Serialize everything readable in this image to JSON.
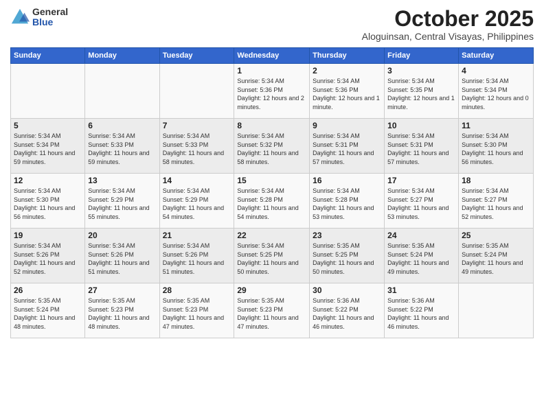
{
  "logo": {
    "general": "General",
    "blue": "Blue"
  },
  "header": {
    "month": "October 2025",
    "location": "Aloguinsan, Central Visayas, Philippines"
  },
  "weekdays": [
    "Sunday",
    "Monday",
    "Tuesday",
    "Wednesday",
    "Thursday",
    "Friday",
    "Saturday"
  ],
  "weeks": [
    [
      {
        "day": "",
        "sunrise": "",
        "sunset": "",
        "daylight": ""
      },
      {
        "day": "",
        "sunrise": "",
        "sunset": "",
        "daylight": ""
      },
      {
        "day": "",
        "sunrise": "",
        "sunset": "",
        "daylight": ""
      },
      {
        "day": "1",
        "sunrise": "Sunrise: 5:34 AM",
        "sunset": "Sunset: 5:36 PM",
        "daylight": "Daylight: 12 hours and 2 minutes."
      },
      {
        "day": "2",
        "sunrise": "Sunrise: 5:34 AM",
        "sunset": "Sunset: 5:36 PM",
        "daylight": "Daylight: 12 hours and 1 minute."
      },
      {
        "day": "3",
        "sunrise": "Sunrise: 5:34 AM",
        "sunset": "Sunset: 5:35 PM",
        "daylight": "Daylight: 12 hours and 1 minute."
      },
      {
        "day": "4",
        "sunrise": "Sunrise: 5:34 AM",
        "sunset": "Sunset: 5:34 PM",
        "daylight": "Daylight: 12 hours and 0 minutes."
      }
    ],
    [
      {
        "day": "5",
        "sunrise": "Sunrise: 5:34 AM",
        "sunset": "Sunset: 5:34 PM",
        "daylight": "Daylight: 11 hours and 59 minutes."
      },
      {
        "day": "6",
        "sunrise": "Sunrise: 5:34 AM",
        "sunset": "Sunset: 5:33 PM",
        "daylight": "Daylight: 11 hours and 59 minutes."
      },
      {
        "day": "7",
        "sunrise": "Sunrise: 5:34 AM",
        "sunset": "Sunset: 5:33 PM",
        "daylight": "Daylight: 11 hours and 58 minutes."
      },
      {
        "day": "8",
        "sunrise": "Sunrise: 5:34 AM",
        "sunset": "Sunset: 5:32 PM",
        "daylight": "Daylight: 11 hours and 58 minutes."
      },
      {
        "day": "9",
        "sunrise": "Sunrise: 5:34 AM",
        "sunset": "Sunset: 5:31 PM",
        "daylight": "Daylight: 11 hours and 57 minutes."
      },
      {
        "day": "10",
        "sunrise": "Sunrise: 5:34 AM",
        "sunset": "Sunset: 5:31 PM",
        "daylight": "Daylight: 11 hours and 57 minutes."
      },
      {
        "day": "11",
        "sunrise": "Sunrise: 5:34 AM",
        "sunset": "Sunset: 5:30 PM",
        "daylight": "Daylight: 11 hours and 56 minutes."
      }
    ],
    [
      {
        "day": "12",
        "sunrise": "Sunrise: 5:34 AM",
        "sunset": "Sunset: 5:30 PM",
        "daylight": "Daylight: 11 hours and 56 minutes."
      },
      {
        "day": "13",
        "sunrise": "Sunrise: 5:34 AM",
        "sunset": "Sunset: 5:29 PM",
        "daylight": "Daylight: 11 hours and 55 minutes."
      },
      {
        "day": "14",
        "sunrise": "Sunrise: 5:34 AM",
        "sunset": "Sunset: 5:29 PM",
        "daylight": "Daylight: 11 hours and 54 minutes."
      },
      {
        "day": "15",
        "sunrise": "Sunrise: 5:34 AM",
        "sunset": "Sunset: 5:28 PM",
        "daylight": "Daylight: 11 hours and 54 minutes."
      },
      {
        "day": "16",
        "sunrise": "Sunrise: 5:34 AM",
        "sunset": "Sunset: 5:28 PM",
        "daylight": "Daylight: 11 hours and 53 minutes."
      },
      {
        "day": "17",
        "sunrise": "Sunrise: 5:34 AM",
        "sunset": "Sunset: 5:27 PM",
        "daylight": "Daylight: 11 hours and 53 minutes."
      },
      {
        "day": "18",
        "sunrise": "Sunrise: 5:34 AM",
        "sunset": "Sunset: 5:27 PM",
        "daylight": "Daylight: 11 hours and 52 minutes."
      }
    ],
    [
      {
        "day": "19",
        "sunrise": "Sunrise: 5:34 AM",
        "sunset": "Sunset: 5:26 PM",
        "daylight": "Daylight: 11 hours and 52 minutes."
      },
      {
        "day": "20",
        "sunrise": "Sunrise: 5:34 AM",
        "sunset": "Sunset: 5:26 PM",
        "daylight": "Daylight: 11 hours and 51 minutes."
      },
      {
        "day": "21",
        "sunrise": "Sunrise: 5:34 AM",
        "sunset": "Sunset: 5:26 PM",
        "daylight": "Daylight: 11 hours and 51 minutes."
      },
      {
        "day": "22",
        "sunrise": "Sunrise: 5:34 AM",
        "sunset": "Sunset: 5:25 PM",
        "daylight": "Daylight: 11 hours and 50 minutes."
      },
      {
        "day": "23",
        "sunrise": "Sunrise: 5:35 AM",
        "sunset": "Sunset: 5:25 PM",
        "daylight": "Daylight: 11 hours and 50 minutes."
      },
      {
        "day": "24",
        "sunrise": "Sunrise: 5:35 AM",
        "sunset": "Sunset: 5:24 PM",
        "daylight": "Daylight: 11 hours and 49 minutes."
      },
      {
        "day": "25",
        "sunrise": "Sunrise: 5:35 AM",
        "sunset": "Sunset: 5:24 PM",
        "daylight": "Daylight: 11 hours and 49 minutes."
      }
    ],
    [
      {
        "day": "26",
        "sunrise": "Sunrise: 5:35 AM",
        "sunset": "Sunset: 5:24 PM",
        "daylight": "Daylight: 11 hours and 48 minutes."
      },
      {
        "day": "27",
        "sunrise": "Sunrise: 5:35 AM",
        "sunset": "Sunset: 5:23 PM",
        "daylight": "Daylight: 11 hours and 48 minutes."
      },
      {
        "day": "28",
        "sunrise": "Sunrise: 5:35 AM",
        "sunset": "Sunset: 5:23 PM",
        "daylight": "Daylight: 11 hours and 47 minutes."
      },
      {
        "day": "29",
        "sunrise": "Sunrise: 5:35 AM",
        "sunset": "Sunset: 5:23 PM",
        "daylight": "Daylight: 11 hours and 47 minutes."
      },
      {
        "day": "30",
        "sunrise": "Sunrise: 5:36 AM",
        "sunset": "Sunset: 5:22 PM",
        "daylight": "Daylight: 11 hours and 46 minutes."
      },
      {
        "day": "31",
        "sunrise": "Sunrise: 5:36 AM",
        "sunset": "Sunset: 5:22 PM",
        "daylight": "Daylight: 11 hours and 46 minutes."
      },
      {
        "day": "",
        "sunrise": "",
        "sunset": "",
        "daylight": ""
      }
    ]
  ]
}
